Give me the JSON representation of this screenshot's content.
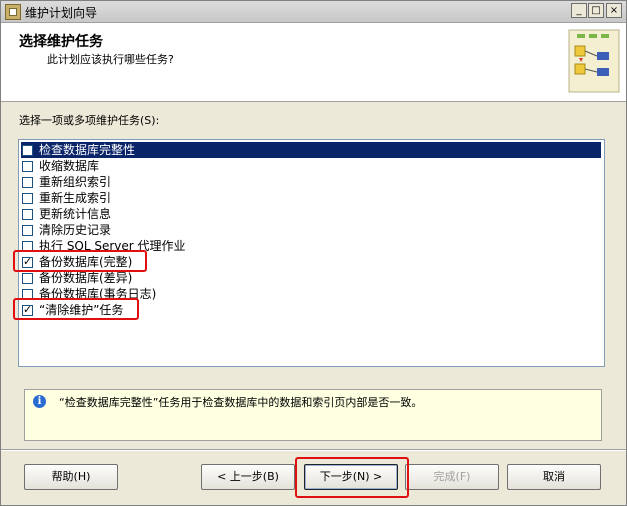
{
  "window": {
    "title": "维护计划向导"
  },
  "titlebar_buttons": {
    "minimize": "_",
    "maximize": "□",
    "close": "×"
  },
  "header": {
    "title": "选择维护任务",
    "subtitle": "此计划应该执行哪些任务?"
  },
  "section_label": "选择一项或多项维护任务(S):",
  "tasks": [
    {
      "label": "检查数据库完整性",
      "checked": false,
      "selected": true
    },
    {
      "label": "收缩数据库",
      "checked": false
    },
    {
      "label": "重新组织索引",
      "checked": false
    },
    {
      "label": "重新生成索引",
      "checked": false
    },
    {
      "label": "更新统计信息",
      "checked": false
    },
    {
      "label": "清除历史记录",
      "checked": false
    },
    {
      "label": "执行 SQL Server 代理作业",
      "checked": false
    },
    {
      "label": "备份数据库(完整)",
      "checked": true
    },
    {
      "label": "备份数据库(差异)",
      "checked": false
    },
    {
      "label": "备份数据库(事务日志)",
      "checked": false
    },
    {
      "label": "“清除维护”任务",
      "checked": true
    }
  ],
  "description": "“检查数据库完整性”任务用于检查数据库中的数据和索引页内部是否一致。",
  "info_icon": "i",
  "buttons": {
    "help": "帮助(H)",
    "back": "< 上一步(B)",
    "next": "下一步(N) >",
    "finish": "完成(F)",
    "cancel": "取消"
  },
  "colors": {
    "highlight": "#e01010",
    "selection": "#0a246a",
    "tooltip_bg": "#ffffe1"
  }
}
